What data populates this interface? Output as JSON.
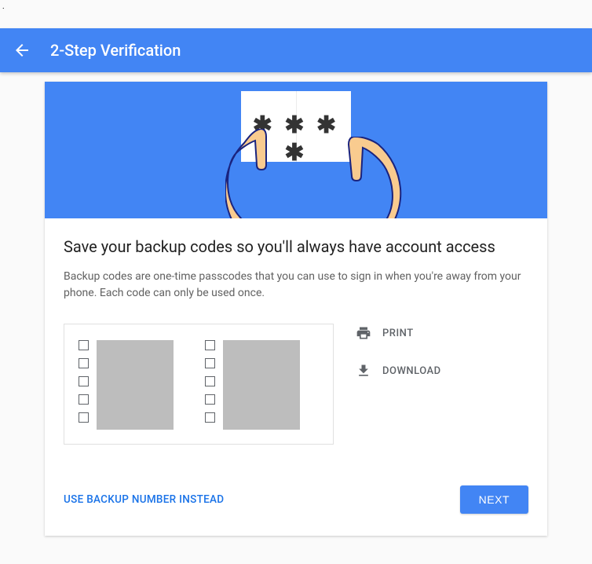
{
  "appbar": {
    "title": "2-Step Verification"
  },
  "hero": {
    "asterisks": "✱ ✱ ✱ ✱"
  },
  "main": {
    "heading": "Save your backup codes so you'll always have account access",
    "description": "Backup codes are one-time passcodes that you can use to sign in when you're away from your phone. Each code can only be used once."
  },
  "codes": {
    "left": [
      "",
      "",
      "",
      "",
      ""
    ],
    "right": [
      "",
      "",
      "",
      "",
      ""
    ]
  },
  "actions": {
    "print": "PRINT",
    "download": "DOWNLOAD"
  },
  "footer": {
    "alt_link": "USE BACKUP NUMBER INSTEAD",
    "next": "NEXT"
  }
}
